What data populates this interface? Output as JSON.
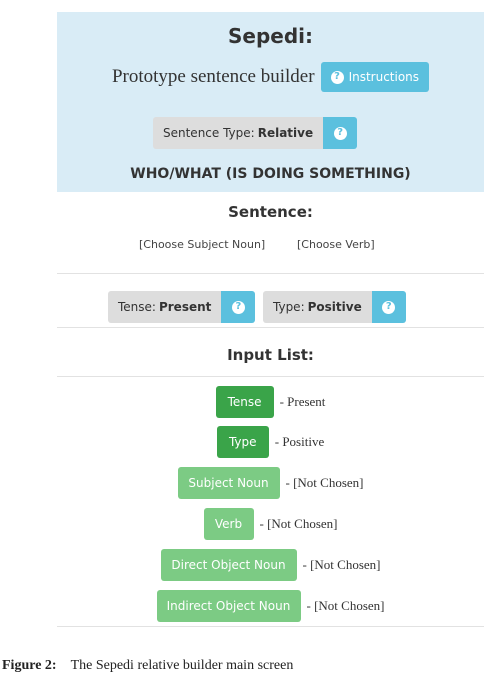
{
  "header": {
    "title": "Sepedi:",
    "subtitle": "Prototype sentence builder",
    "instructions_label": "Instructions",
    "help_glyph": "?"
  },
  "sentence_type": {
    "label": "Sentence Type:",
    "value": "Relative"
  },
  "who_what_heading": "WHO/WHAT (IS DOING SOMETHING)",
  "sentence": {
    "heading": "Sentence:",
    "subject_slot": "[Choose Subject Noun]",
    "verb_slot": "[Choose Verb]"
  },
  "tense": {
    "label": "Tense:",
    "value": "Present"
  },
  "type": {
    "label": "Type:",
    "value": "Positive"
  },
  "input_list": {
    "heading": "Input List:",
    "items": [
      {
        "label": "Tense",
        "value": "- Present"
      },
      {
        "label": "Type",
        "value": "- Positive"
      },
      {
        "label": "Subject Noun",
        "value": "- [Not Chosen]"
      },
      {
        "label": "Verb",
        "value": "- [Not Chosen]"
      },
      {
        "label": "Direct Object Noun",
        "value": "- [Not Chosen]"
      },
      {
        "label": "Indirect Object Noun",
        "value": "- [Not Chosen]"
      }
    ]
  },
  "caption": {
    "figure": "Figure 2:",
    "text": "The Sepedi relative builder main screen"
  },
  "colors": {
    "header_bg": "#d9ecf6",
    "info_blue": "#5bc0de",
    "set_green": "#3aa449",
    "unset_green": "#7ccb84",
    "neutral_grey": "#dddddd"
  },
  "icons": {
    "help": "question-circle-icon"
  }
}
